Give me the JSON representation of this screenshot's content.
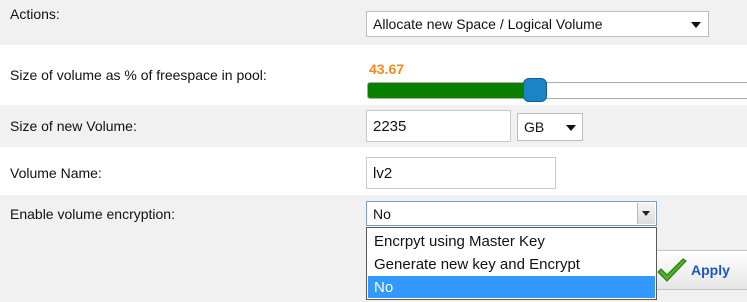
{
  "actions": {
    "label": "Actions:",
    "selected": "Allocate new Space / Logical Volume"
  },
  "size_percent": {
    "label": "Size of volume as % of freespace in pool:",
    "value_text": "43.67",
    "value": 43.67
  },
  "size_new": {
    "label": "Size of new Volume:",
    "value": "2235",
    "unit": "GB"
  },
  "volume_name": {
    "label": "Volume Name:",
    "value": "lv2"
  },
  "encryption": {
    "label": "Enable volume encryption:",
    "selected": "No",
    "options": [
      "Encrpyt using Master Key",
      "Generate new key and Encrypt",
      "No"
    ]
  },
  "apply_button": {
    "label": "Apply"
  },
  "colors": {
    "slider_value": "#f08a1c",
    "slider_fill": "#0a8000",
    "slider_handle": "#1a84c4",
    "selected_option": "#3399ff",
    "apply_text": "#1b55c4"
  },
  "icons": {
    "apply": "checkmark-icon",
    "select_caret": "chevron-down-icon"
  }
}
